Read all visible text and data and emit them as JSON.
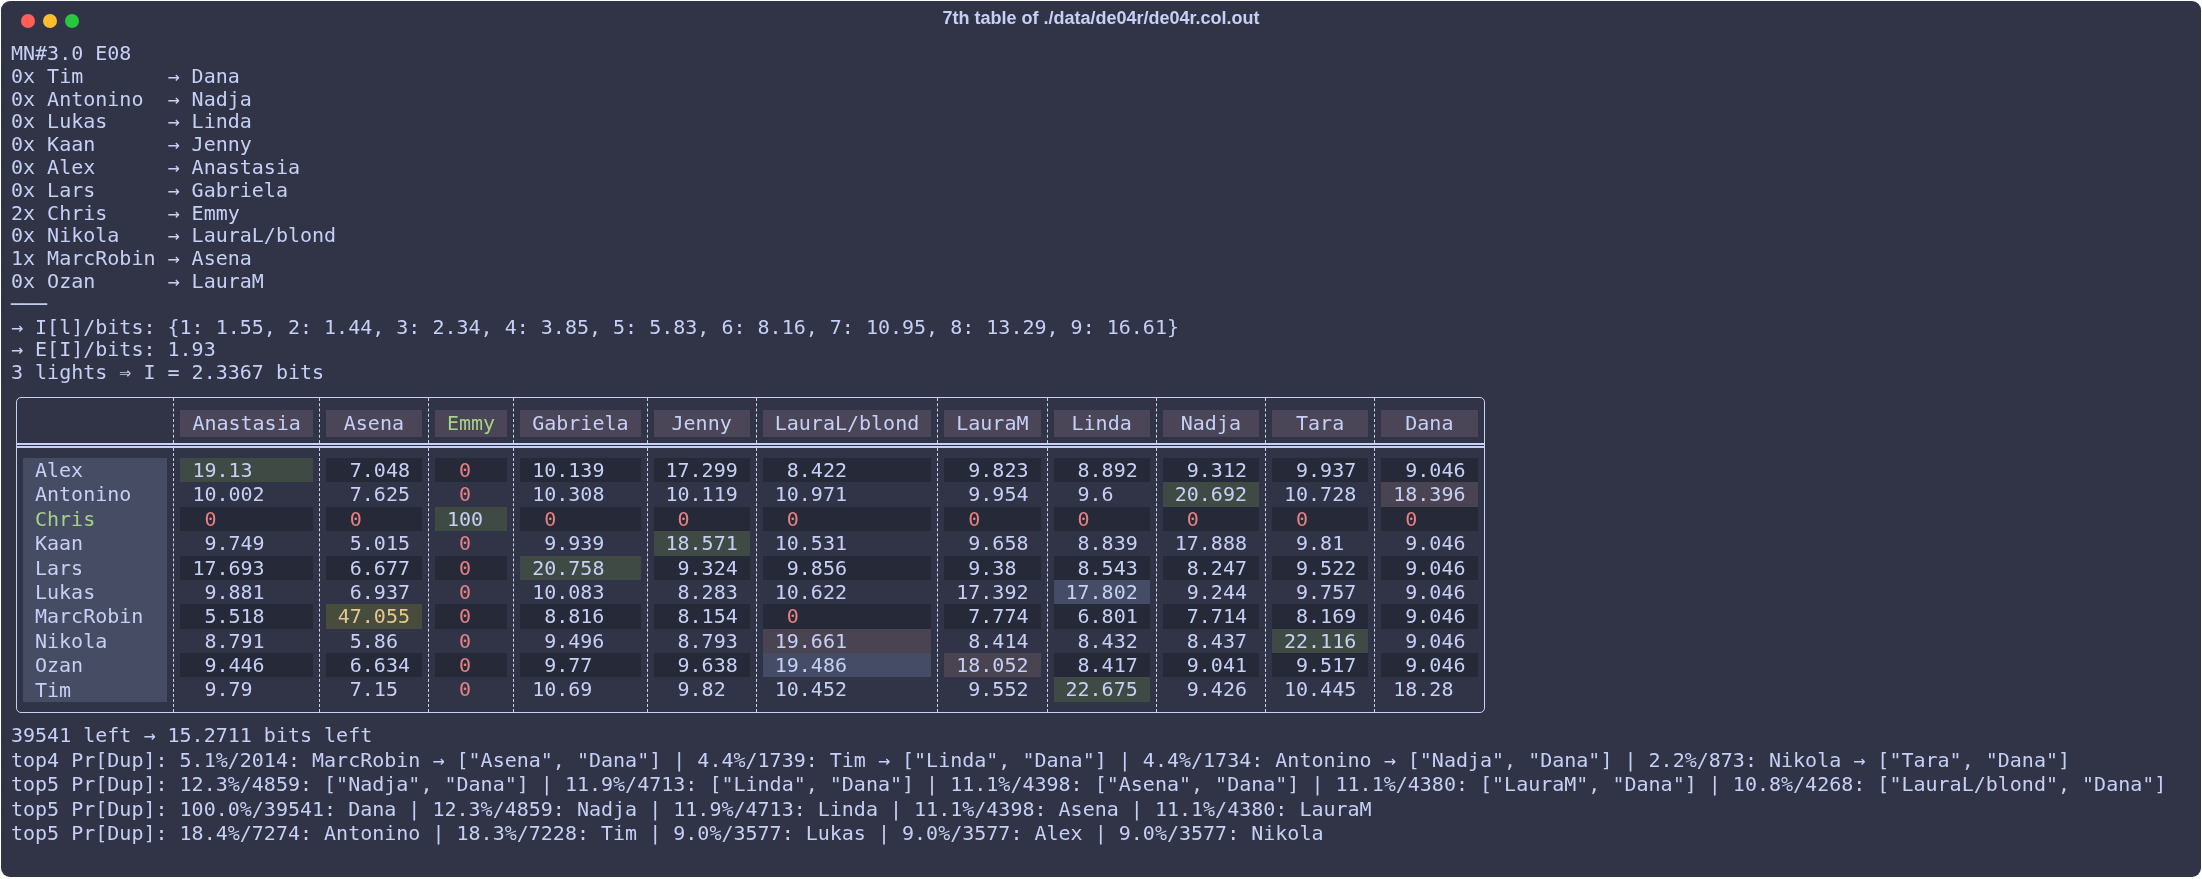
{
  "window": {
    "title": "7th table of ./data/de04r/de04r.col.out"
  },
  "output_lines": [
    "MN#3.0 E08",
    "0x Tim       → Dana",
    "0x Antonino  → Nadja",
    "0x Lukas     → Linda",
    "0x Kaan      → Jenny",
    "0x Alex      → Anastasia",
    "0x Lars      → Gabriela",
    "2x Chris     → Emmy",
    "0x Nikola    → LauraL/blond",
    "1x MarcRobin → Asena",
    "0x Ozan      → LauraM",
    "───",
    "→ I[l]/bits: {1: 1.55, 2: 1.44, 3: 2.34, 4: 3.85, 5: 5.83, 6: 8.16, 7: 10.95, 8: 13.29, 9: 16.61}",
    "→ E[I]/bits: 1.93",
    "3 lights ⇒ I = 2.3367 bits"
  ],
  "table": {
    "columns": [
      {
        "name": "Anastasia",
        "highlight": false
      },
      {
        "name": "Asena",
        "highlight": false
      },
      {
        "name": "Emmy",
        "highlight": true
      },
      {
        "name": "Gabriela",
        "highlight": false
      },
      {
        "name": "Jenny",
        "highlight": false
      },
      {
        "name": "LauraL/blond",
        "highlight": false
      },
      {
        "name": "LauraM",
        "highlight": false
      },
      {
        "name": "Linda",
        "highlight": false
      },
      {
        "name": "Nadja",
        "highlight": false
      },
      {
        "name": "Tara",
        "highlight": false
      },
      {
        "name": "Dana",
        "highlight": false
      }
    ],
    "rows": [
      {
        "name": "Alex",
        "highlight": false,
        "cells": [
          {
            "text": "19.13",
            "kind": "green"
          },
          {
            "text": "7.048",
            "kind": "plain"
          },
          {
            "text": "0",
            "kind": "zero"
          },
          {
            "text": "10.139",
            "kind": "plain"
          },
          {
            "text": "17.299",
            "kind": "plain"
          },
          {
            "text": "8.422",
            "kind": "plain"
          },
          {
            "text": "9.823",
            "kind": "plain"
          },
          {
            "text": "8.892",
            "kind": "plain"
          },
          {
            "text": "9.312",
            "kind": "plain"
          },
          {
            "text": "9.937",
            "kind": "plain"
          },
          {
            "text": "9.046",
            "kind": "plain"
          }
        ]
      },
      {
        "name": "Antonino",
        "highlight": false,
        "cells": [
          {
            "text": "10.002",
            "kind": "plain"
          },
          {
            "text": "7.625",
            "kind": "plain"
          },
          {
            "text": "0",
            "kind": "zero"
          },
          {
            "text": "10.308",
            "kind": "plain"
          },
          {
            "text": "10.119",
            "kind": "plain"
          },
          {
            "text": "10.971",
            "kind": "plain"
          },
          {
            "text": "9.954",
            "kind": "plain"
          },
          {
            "text": "9.6",
            "kind": "plain"
          },
          {
            "text": "20.692",
            "kind": "green"
          },
          {
            "text": "10.728",
            "kind": "plain"
          },
          {
            "text": "18.396",
            "kind": "pink"
          }
        ]
      },
      {
        "name": "Chris",
        "highlight": true,
        "cells": [
          {
            "text": "0",
            "kind": "zero"
          },
          {
            "text": "0",
            "kind": "zero"
          },
          {
            "text": "100",
            "kind": "green"
          },
          {
            "text": "0",
            "kind": "zero"
          },
          {
            "text": "0",
            "kind": "zero"
          },
          {
            "text": "0",
            "kind": "zero"
          },
          {
            "text": "0",
            "kind": "zero"
          },
          {
            "text": "0",
            "kind": "zero"
          },
          {
            "text": "0",
            "kind": "zero"
          },
          {
            "text": "0",
            "kind": "zero"
          },
          {
            "text": "0",
            "kind": "zero"
          }
        ]
      },
      {
        "name": "Kaan",
        "highlight": false,
        "cells": [
          {
            "text": "9.749",
            "kind": "plain"
          },
          {
            "text": "5.015",
            "kind": "plain"
          },
          {
            "text": "0",
            "kind": "zero"
          },
          {
            "text": "9.939",
            "kind": "plain"
          },
          {
            "text": "18.571",
            "kind": "green"
          },
          {
            "text": "10.531",
            "kind": "plain"
          },
          {
            "text": "9.658",
            "kind": "plain"
          },
          {
            "text": "8.839",
            "kind": "plain"
          },
          {
            "text": "17.888",
            "kind": "plain"
          },
          {
            "text": "9.81",
            "kind": "plain"
          },
          {
            "text": "9.046",
            "kind": "plain"
          }
        ]
      },
      {
        "name": "Lars",
        "highlight": false,
        "cells": [
          {
            "text": "17.693",
            "kind": "plain"
          },
          {
            "text": "6.677",
            "kind": "plain"
          },
          {
            "text": "0",
            "kind": "zero"
          },
          {
            "text": "20.758",
            "kind": "green"
          },
          {
            "text": "9.324",
            "kind": "plain"
          },
          {
            "text": "9.856",
            "kind": "plain"
          },
          {
            "text": "9.38",
            "kind": "plain"
          },
          {
            "text": "8.543",
            "kind": "plain"
          },
          {
            "text": "8.247",
            "kind": "plain"
          },
          {
            "text": "9.522",
            "kind": "plain"
          },
          {
            "text": "9.046",
            "kind": "plain"
          }
        ]
      },
      {
        "name": "Lukas",
        "highlight": false,
        "cells": [
          {
            "text": "9.881",
            "kind": "plain"
          },
          {
            "text": "6.937",
            "kind": "plain"
          },
          {
            "text": "0",
            "kind": "zero"
          },
          {
            "text": "10.083",
            "kind": "plain"
          },
          {
            "text": "8.283",
            "kind": "plain"
          },
          {
            "text": "10.622",
            "kind": "plain"
          },
          {
            "text": "17.392",
            "kind": "plain"
          },
          {
            "text": "17.802",
            "kind": "blue"
          },
          {
            "text": "9.244",
            "kind": "plain"
          },
          {
            "text": "9.757",
            "kind": "plain"
          },
          {
            "text": "9.046",
            "kind": "plain"
          }
        ]
      },
      {
        "name": "MarcRobin",
        "highlight": false,
        "cells": [
          {
            "text": "5.518",
            "kind": "plain"
          },
          {
            "text": "47.055",
            "kind": "yellow"
          },
          {
            "text": "0",
            "kind": "zero"
          },
          {
            "text": "8.816",
            "kind": "plain"
          },
          {
            "text": "8.154",
            "kind": "plain"
          },
          {
            "text": "0",
            "kind": "zero"
          },
          {
            "text": "7.774",
            "kind": "plain"
          },
          {
            "text": "6.801",
            "kind": "plain"
          },
          {
            "text": "7.714",
            "kind": "plain"
          },
          {
            "text": "8.169",
            "kind": "plain"
          },
          {
            "text": "9.046",
            "kind": "plain"
          }
        ]
      },
      {
        "name": "Nikola",
        "highlight": false,
        "cells": [
          {
            "text": "8.791",
            "kind": "plain"
          },
          {
            "text": "5.86",
            "kind": "plain"
          },
          {
            "text": "0",
            "kind": "zero"
          },
          {
            "text": "9.496",
            "kind": "plain"
          },
          {
            "text": "8.793",
            "kind": "plain"
          },
          {
            "text": "19.661",
            "kind": "pink"
          },
          {
            "text": "8.414",
            "kind": "plain"
          },
          {
            "text": "8.432",
            "kind": "plain"
          },
          {
            "text": "8.437",
            "kind": "plain"
          },
          {
            "text": "22.116",
            "kind": "green"
          },
          {
            "text": "9.046",
            "kind": "plain"
          }
        ]
      },
      {
        "name": "Ozan",
        "highlight": false,
        "cells": [
          {
            "text": "9.446",
            "kind": "plain"
          },
          {
            "text": "6.634",
            "kind": "plain"
          },
          {
            "text": "0",
            "kind": "zero"
          },
          {
            "text": "9.77",
            "kind": "plain"
          },
          {
            "text": "9.638",
            "kind": "plain"
          },
          {
            "text": "19.486",
            "kind": "blue"
          },
          {
            "text": "18.052",
            "kind": "pink"
          },
          {
            "text": "8.417",
            "kind": "plain"
          },
          {
            "text": "9.041",
            "kind": "plain"
          },
          {
            "text": "9.517",
            "kind": "plain"
          },
          {
            "text": "9.046",
            "kind": "plain"
          }
        ]
      },
      {
        "name": "Tim",
        "highlight": false,
        "cells": [
          {
            "text": "9.79",
            "kind": "plain"
          },
          {
            "text": "7.15",
            "kind": "plain"
          },
          {
            "text": "0",
            "kind": "zero"
          },
          {
            "text": "10.69",
            "kind": "plain"
          },
          {
            "text": "9.82",
            "kind": "plain"
          },
          {
            "text": "10.452",
            "kind": "plain"
          },
          {
            "text": "9.552",
            "kind": "plain"
          },
          {
            "text": "22.675",
            "kind": "green"
          },
          {
            "text": "9.426",
            "kind": "plain"
          },
          {
            "text": "10.445",
            "kind": "plain"
          },
          {
            "text": "18.28",
            "kind": "plain"
          }
        ]
      }
    ]
  },
  "summary_lines": [
    "39541 left → 15.2711 bits left",
    "top4 Pr[Dup]: 5.1%/2014: MarcRobin → [\"Asena\", \"Dana\"] | 4.4%/1739: Tim → [\"Linda\", \"Dana\"] | 4.4%/1734: Antonino → [\"Nadja\", \"Dana\"] | 2.2%/873: Nikola → [\"Tara\", \"Dana\"]",
    "top5 Pr[Dup]: 12.3%/4859: [\"Nadja\", \"Dana\"] | 11.9%/4713: [\"Linda\", \"Dana\"] | 11.1%/4398: [\"Asena\", \"Dana\"] | 11.1%/4380: [\"LauraM\", \"Dana\"] | 10.8%/4268: [\"LauraL/blond\", \"Dana\"]",
    "top5 Pr[Dup]: 100.0%/39541: Dana | 12.3%/4859: Nadja | 11.9%/4713: Linda | 11.1%/4398: Asena | 11.1%/4380: LauraM",
    "top5 Pr[Dup]: 18.4%/7274: Antonino | 18.3%/7228: Tim | 9.0%/3577: Lukas | 9.0%/3577: Alex | 9.0%/3577: Nikola"
  ]
}
